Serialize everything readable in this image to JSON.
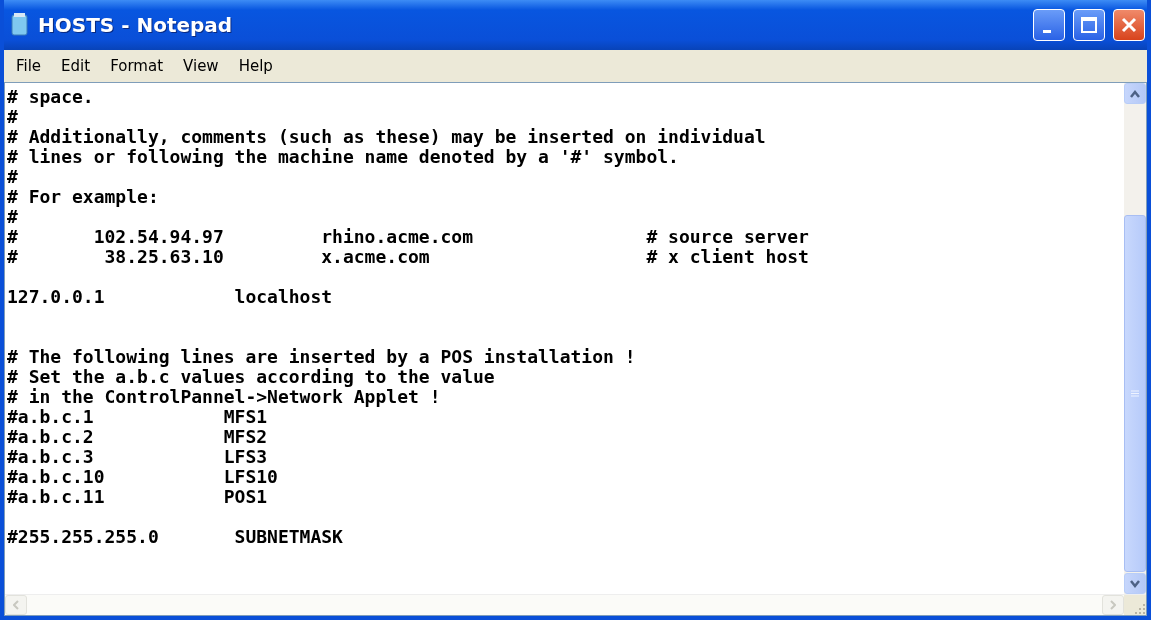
{
  "window": {
    "title": "HOSTS - Notepad"
  },
  "menu": [
    {
      "label": "File"
    },
    {
      "label": "Edit"
    },
    {
      "label": "Format"
    },
    {
      "label": "View"
    },
    {
      "label": "Help"
    }
  ],
  "document": {
    "lines": [
      {
        "kind": "text",
        "text": "# space."
      },
      {
        "kind": "text",
        "text": "#"
      },
      {
        "kind": "text",
        "text": "# Additionally, comments (such as these) may be inserted on individual"
      },
      {
        "kind": "text",
        "text": "# lines or following the machine name denoted by a '#' symbol."
      },
      {
        "kind": "text",
        "text": "#"
      },
      {
        "kind": "text",
        "text": "# For example:"
      },
      {
        "kind": "text",
        "text": "#"
      },
      {
        "kind": "text",
        "text": "#       102.54.94.97         rhino.acme.com                # source server"
      },
      {
        "kind": "text",
        "text": "#        38.25.63.10         x.acme.com                    # x client host"
      },
      {
        "kind": "blank"
      },
      {
        "kind": "text",
        "text": "127.0.0.1            localhost"
      },
      {
        "kind": "blank"
      },
      {
        "kind": "blank"
      },
      {
        "kind": "text",
        "text": "# The following lines are inserted by a POS installation !"
      },
      {
        "kind": "text",
        "text": "# Set the a.b.c values according to the value"
      },
      {
        "kind": "text",
        "text": "# in the ControlPannel->Network Applet !"
      },
      {
        "kind": "text",
        "text": "#a.b.c.1            MFS1"
      },
      {
        "kind": "text",
        "text": "#a.b.c.2            MFS2"
      },
      {
        "kind": "text",
        "text": "#a.b.c.3            LFS3"
      },
      {
        "kind": "text",
        "text": "#a.b.c.10           LFS10"
      },
      {
        "kind": "text",
        "text": "#a.b.c.11           POS1"
      },
      {
        "kind": "blank"
      },
      {
        "kind": "text",
        "text": "#255.255.255.0       SUBNETMASK"
      }
    ]
  }
}
